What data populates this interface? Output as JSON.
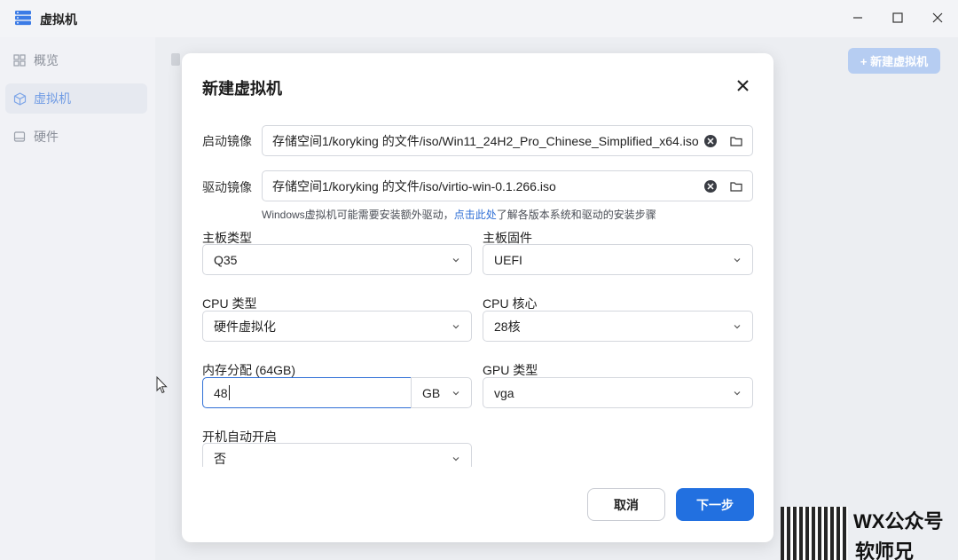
{
  "window": {
    "title": "虚拟机",
    "icon": "server-stack-icon",
    "controls": [
      "minimize-icon",
      "maximize-icon",
      "close-icon"
    ]
  },
  "sidebar": {
    "items": [
      {
        "label": "概览",
        "icon": "grid-icon",
        "active": false
      },
      {
        "label": "虚拟机",
        "icon": "cube-icon",
        "active": true
      },
      {
        "label": "硬件",
        "icon": "drive-icon",
        "active": false
      }
    ]
  },
  "main": {
    "new_vm_button": "+ 新建虚拟机"
  },
  "dialog": {
    "title": "新建虚拟机",
    "boot_image": {
      "label": "启动镜像",
      "value": "存储空间1/koryking 的文件/iso/Win11_24H2_Pro_Chinese_Simplified_x64.iso"
    },
    "driver_image": {
      "label": "驱动镜像",
      "value": "存储空间1/koryking 的文件/iso/virtio-win-0.1.266.iso"
    },
    "hint": {
      "prefix": "Windows虚拟机可能需要安装额外驱动，",
      "link": "点击此处",
      "suffix": "了解各版本系统和驱动的安装步骤"
    },
    "board_type": {
      "label": "主板类型",
      "value": "Q35"
    },
    "firmware": {
      "label": "主板固件",
      "value": "UEFI"
    },
    "cpu_type": {
      "label": "CPU 类型",
      "value": "硬件虚拟化"
    },
    "cpu_cores": {
      "label": "CPU 核心",
      "value": "28核"
    },
    "memory": {
      "label": "内存分配 (64GB)",
      "value": "48",
      "unit": "GB"
    },
    "gpu_type": {
      "label": "GPU 类型",
      "value": "vga"
    },
    "autostart": {
      "label": "开机自动开启",
      "value": "否"
    },
    "cancel_label": "取消",
    "next_label": "下一步"
  },
  "watermark": {
    "line1": "WX公众号",
    "line2": "软师兄"
  },
  "colors": {
    "accent": "#2270e0",
    "link": "#2f6fd6",
    "disabled_button": "#b6cdf2"
  }
}
